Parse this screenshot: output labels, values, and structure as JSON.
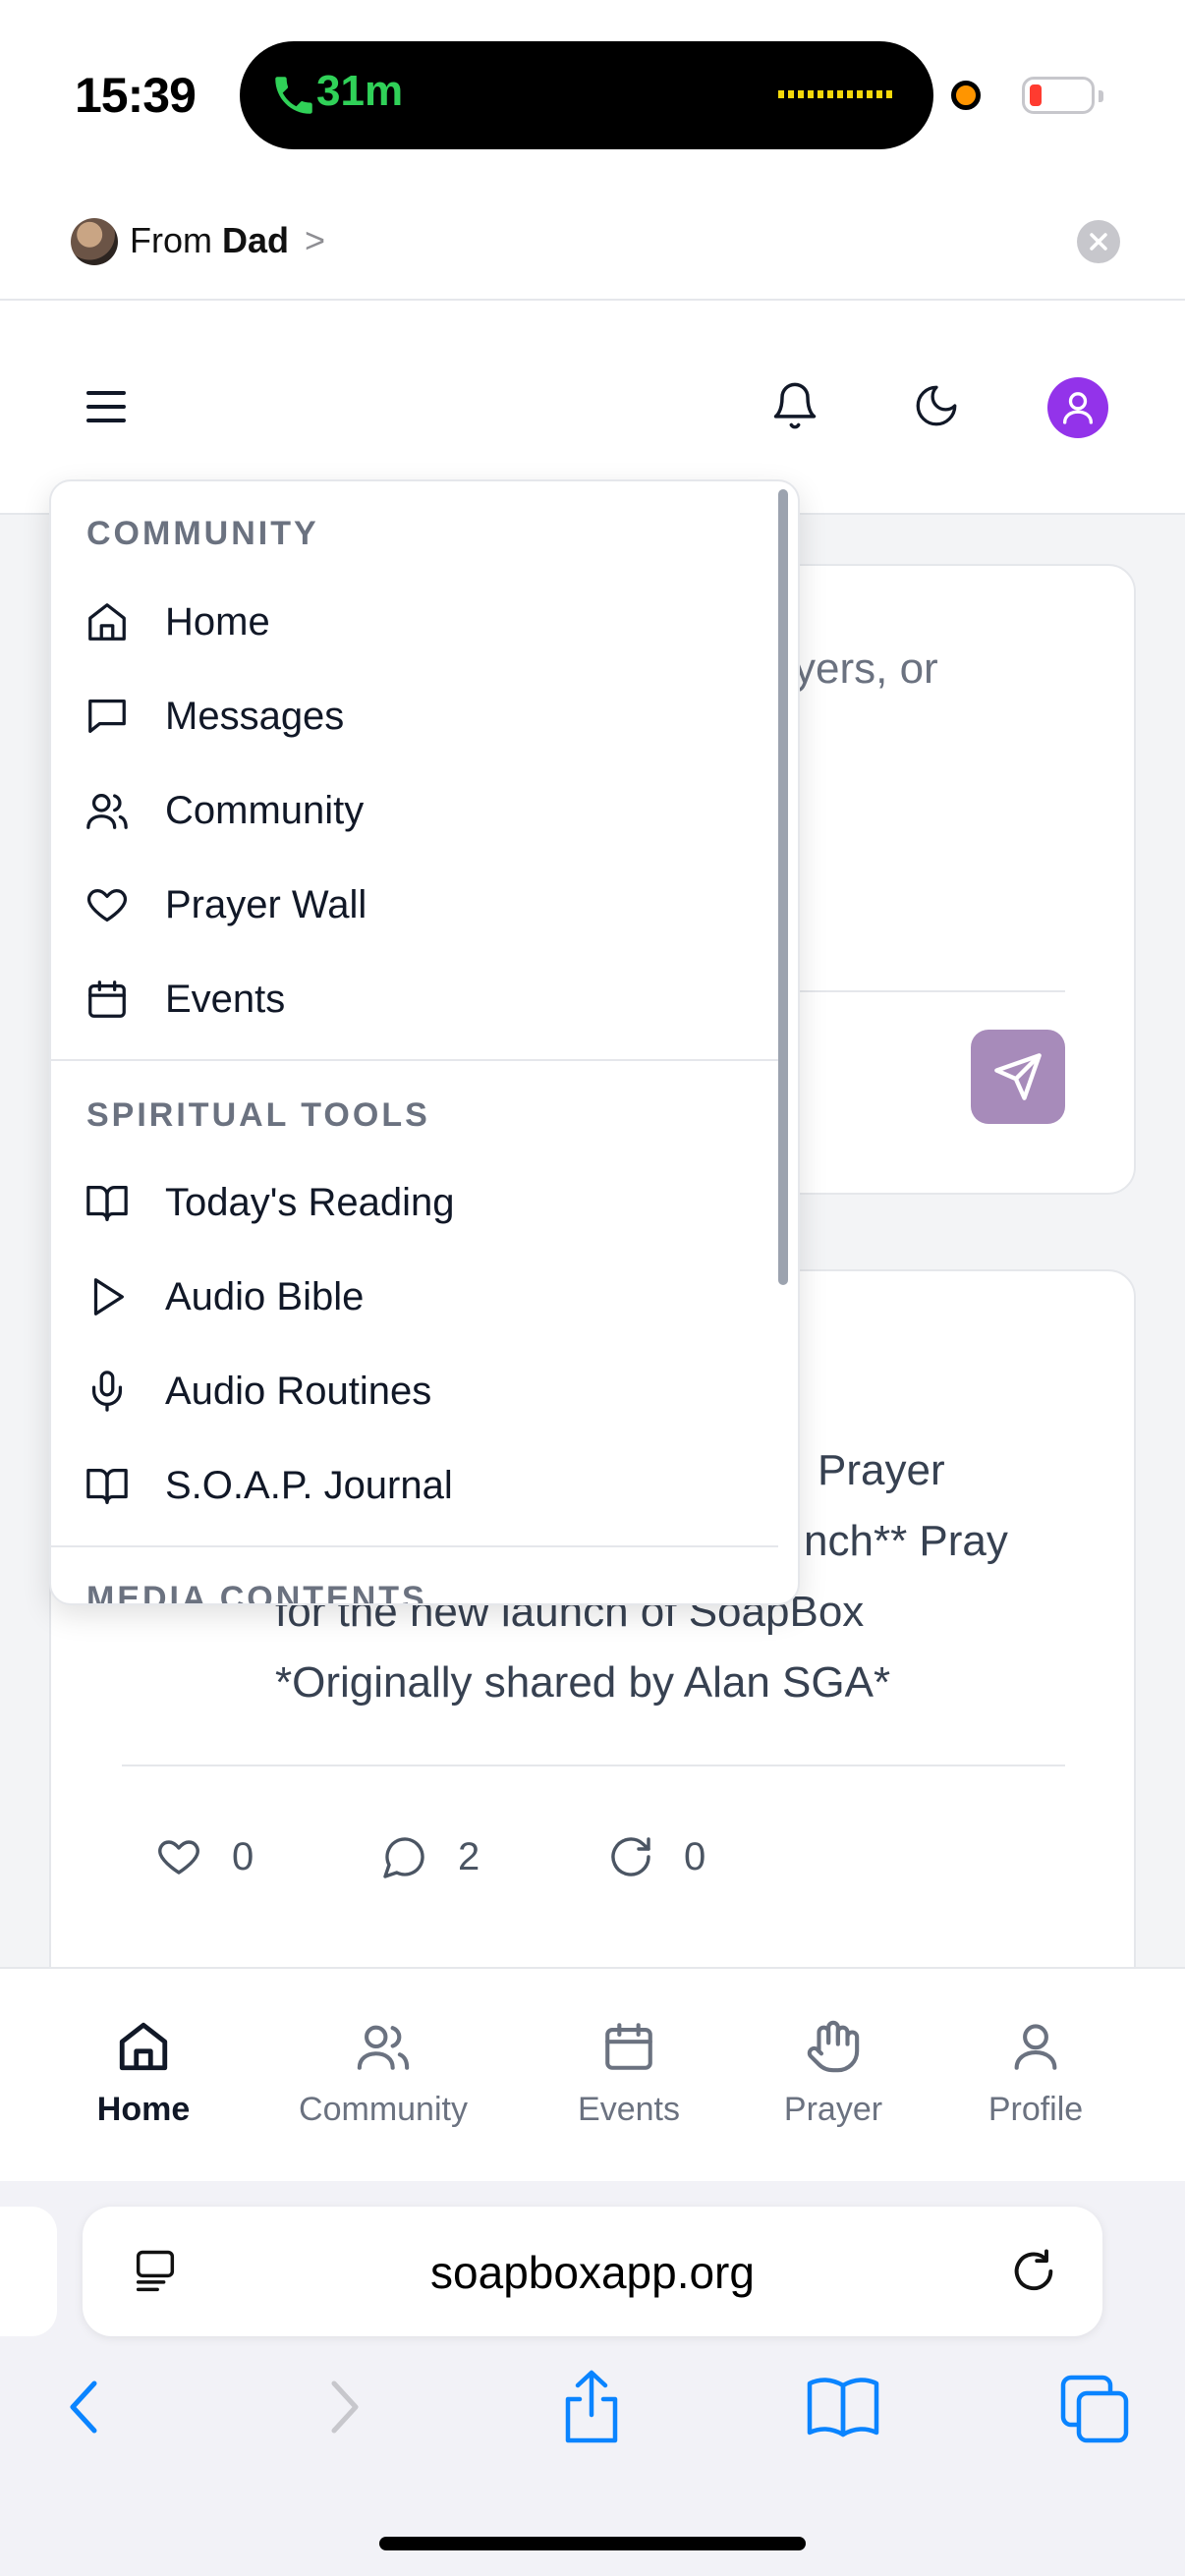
{
  "status_bar": {
    "time": "15:39",
    "call_duration": "31m",
    "call_color": "#30d158"
  },
  "share_strip": {
    "prefix": "From",
    "sender": "Dad",
    "chevron": ">"
  },
  "header": {
    "menu_icon": "hamburger-icon",
    "notifications_icon": "bell-icon",
    "theme_icon": "moon-icon",
    "profile_icon": "user-icon",
    "accent": "#9333ea"
  },
  "composer": {
    "placeholder_fragment": "yers, or",
    "send_color": "#a78bba"
  },
  "post": {
    "lines": [
      "Prayer",
      "nch** Pray",
      "for the new launch of SoapBox",
      "*Originally shared by Alan SGA*"
    ],
    "likes": "0",
    "comments": "2",
    "reposts": "0"
  },
  "menu": {
    "sections": [
      {
        "title": "COMMUNITY",
        "items": [
          {
            "label": "Home",
            "icon": "home-icon"
          },
          {
            "label": "Messages",
            "icon": "message-icon"
          },
          {
            "label": "Community",
            "icon": "users-icon"
          },
          {
            "label": "Prayer Wall",
            "icon": "heart-icon"
          },
          {
            "label": "Events",
            "icon": "calendar-icon"
          }
        ]
      },
      {
        "title": "SPIRITUAL TOOLS",
        "items": [
          {
            "label": "Today's Reading",
            "icon": "book-open-icon"
          },
          {
            "label": "Audio Bible",
            "icon": "play-icon"
          },
          {
            "label": "Audio Routines",
            "icon": "microphone-icon"
          },
          {
            "label": "S.O.A.P. Journal",
            "icon": "book-open-icon"
          }
        ]
      },
      {
        "title": "MEDIA CONTENTS",
        "items": []
      }
    ]
  },
  "bottom_nav": {
    "items": [
      {
        "label": "Home",
        "icon": "home-icon",
        "active": true
      },
      {
        "label": "Community",
        "icon": "users-icon",
        "active": false
      },
      {
        "label": "Events",
        "icon": "calendar-icon",
        "active": false
      },
      {
        "label": "Prayer",
        "icon": "hand-icon",
        "active": false
      },
      {
        "label": "Profile",
        "icon": "user-icon",
        "active": false
      }
    ]
  },
  "browser": {
    "url": "soapboxapp.org",
    "accent": "#0a84ff"
  }
}
